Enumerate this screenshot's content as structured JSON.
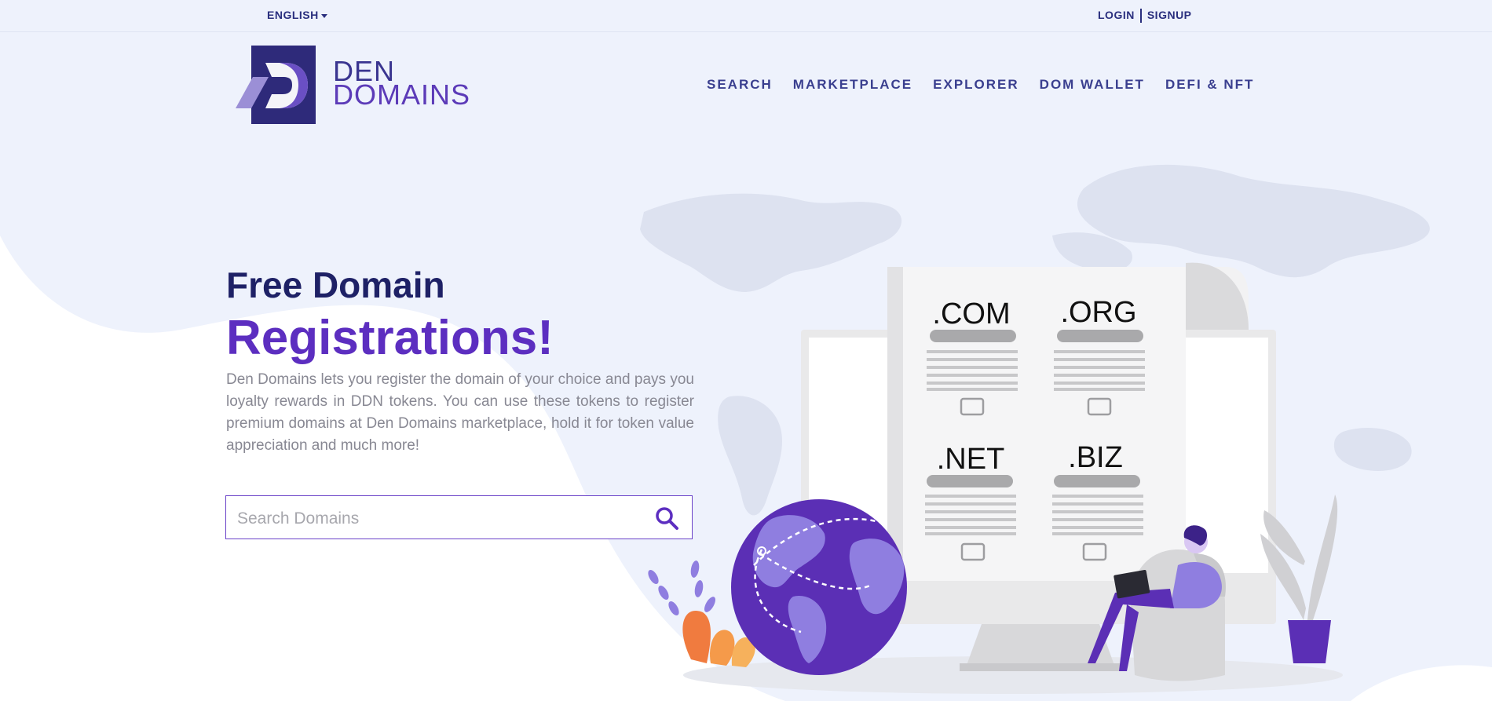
{
  "topbar": {
    "language": "ENGLISH",
    "login": "LOGIN",
    "signup": "SIGNUP"
  },
  "brand": {
    "line1": "DEN",
    "line2": "DOMAINS"
  },
  "nav": [
    {
      "label": "SEARCH"
    },
    {
      "label": "MARKETPLACE"
    },
    {
      "label": "EXPLORER"
    },
    {
      "label": "DOM WALLET"
    },
    {
      "label": "DEFI & NFT"
    }
  ],
  "hero": {
    "title_line1": "Free Domain",
    "title_line2": "Registrations!",
    "description": "Den Domains lets you register the domain of your choice and pays you loyalty rewards in DDN tokens. You can use these tokens to register premium domains at Den Domains marketplace, hold it for token value appreciation and much more!",
    "search_placeholder": "Search Domains"
  },
  "illustration": {
    "tld_com": ".COM",
    "tld_org": ".ORG",
    "tld_net": ".NET",
    "tld_biz": ".BIZ"
  },
  "colors": {
    "primary": "#5c2ec0",
    "navy": "#1e2166",
    "background": "#eef2fc"
  }
}
